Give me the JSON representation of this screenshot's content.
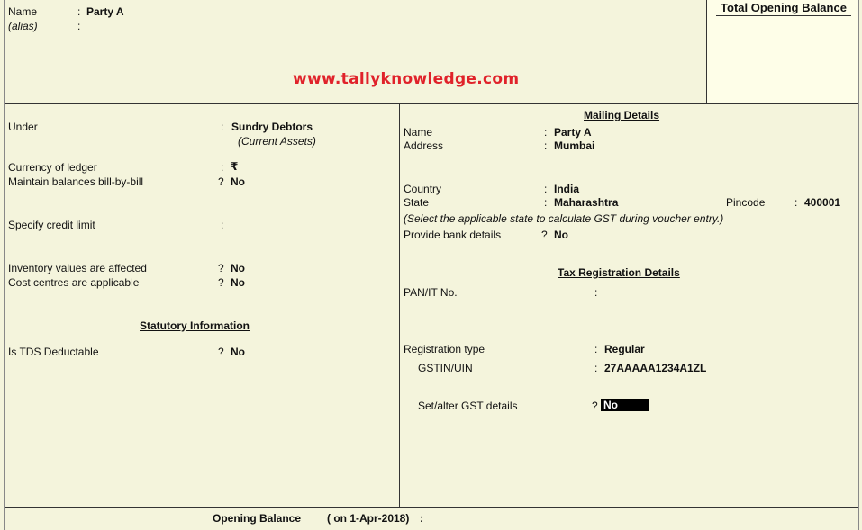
{
  "header": {
    "name_label": "Name",
    "name_sep": ":",
    "name_value": "Party A",
    "alias_label": "(alias)",
    "alias_sep": ":",
    "total_opening_balance_title": "Total Opening Balance"
  },
  "watermark": "www.tallyknowledge.com",
  "left": {
    "under_label": "Under",
    "under_sep": ":",
    "under_value": "Sundry Debtors",
    "under_sub": "(Current Assets)",
    "currency_label": "Currency of ledger",
    "currency_sep": ":",
    "currency_value": "₹",
    "bill_by_bill_label": "Maintain balances bill-by-bill",
    "bill_by_bill_sep": "?",
    "bill_by_bill_value": "No",
    "credit_limit_label": "Specify credit limit",
    "credit_limit_sep": ":",
    "inventory_label": "Inventory values are affected",
    "inventory_sep": "?",
    "inventory_value": "No",
    "cost_centres_label": "Cost centres are applicable",
    "cost_centres_sep": "?",
    "cost_centres_value": "No",
    "statutory_title": "Statutory Information",
    "tds_label": "Is TDS Deductable",
    "tds_sep": "?",
    "tds_value": "No"
  },
  "right": {
    "mailing_title": "Mailing Details",
    "name_label": "Name",
    "name_sep": ":",
    "name_value": "Party A",
    "address_label": "Address",
    "address_sep": ":",
    "address_value": "Mumbai",
    "country_label": "Country",
    "country_sep": ":",
    "country_value": "India",
    "state_label": "State",
    "state_sep": ":",
    "state_value": "Maharashtra",
    "pincode_label": "Pincode",
    "pincode_sep": ":",
    "pincode_value": "400001",
    "state_note": "(Select the applicable state to calculate GST during voucher entry.)",
    "bank_label": "Provide bank details",
    "bank_sep": "?",
    "bank_value": "No",
    "tax_title": "Tax Registration Details",
    "pan_label": "PAN/IT No.",
    "pan_sep": ":",
    "reg_type_label": "Registration type",
    "reg_type_sep": ":",
    "reg_type_value": "Regular",
    "gstin_label": "GSTIN/UIN",
    "gstin_sep": ":",
    "gstin_value": "27AAAAA1234A1ZL",
    "gst_details_label": "Set/alter GST details",
    "gst_details_sep": "?",
    "gst_details_value": "No"
  },
  "footer": {
    "opening_balance_label": "Opening Balance",
    "opening_balance_date": "( on 1-Apr-2018)",
    "opening_balance_sep": ":"
  }
}
